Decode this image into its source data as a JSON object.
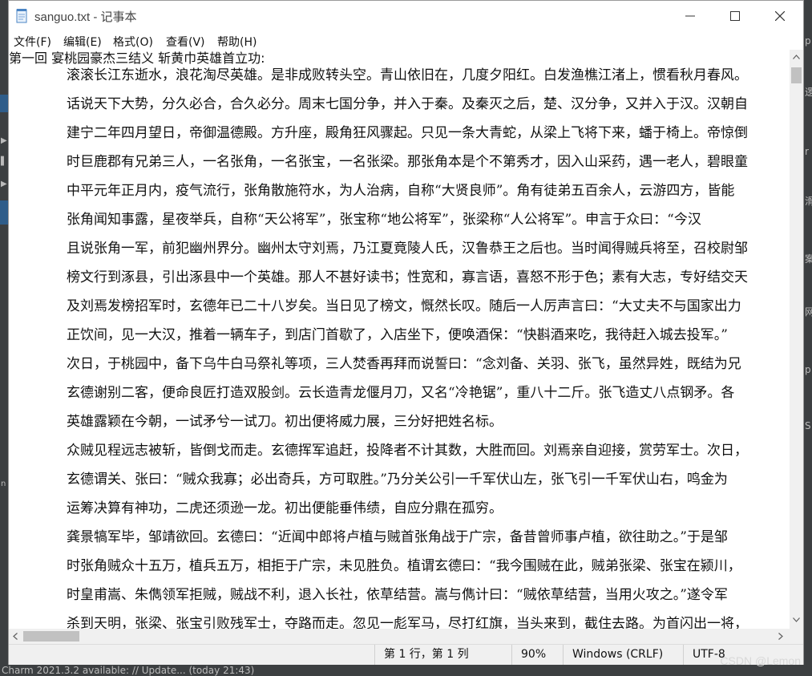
{
  "window": {
    "title": "sanguo.txt - 记事本",
    "minimize_glyph": "─",
    "maximize_glyph": "☐",
    "close_glyph": "✕"
  },
  "menu": [
    "文件(F)",
    "编辑(E)",
    "格式(O)",
    "查看(V)",
    "帮助(H)"
  ],
  "editor": {
    "heading": "第一回  宴桃园豪杰三结义  斩黄巾英雄首立功:",
    "lines": [
      "滚滚长江东逝水，浪花淘尽英雄。是非成败转头空。青山依旧在，几度夕阳红。白发渔樵江渚上，惯看秋月春风。",
      "话说天下大势，分久必合，合久必分。周末七国分争，并入于秦。及秦灭之后，楚、汉分争，又并入于汉。汉朝自",
      "建宁二年四月望日，帝御温德殿。方升座，殿角狂风骤起。只见一条大青蛇，从梁上飞将下来，蟠于椅上。帝惊倒",
      "时巨鹿郡有兄弟三人，一名张角，一名张宝，一名张梁。那张角本是个不第秀才，因入山采药，遇一老人，碧眼童",
      "中平元年正月内，疫气流行，张角散施符水，为人治病，自称“大贤良师”。角有徒弟五百余人，云游四方，皆能",
      "张角闻知事露，星夜举兵，自称“天公将军”，张宝称“地公将军”，张梁称“人公将军”。申言于众曰：“今汉",
      "且说张角一军，前犯幽州界分。幽州太守刘焉，乃江夏竟陵人氏，汉鲁恭王之后也。当时闻得贼兵将至，召校尉邹",
      "榜文行到涿县，引出涿县中一个英雄。那人不甚好读书；性宽和，寡言语，喜怒不形于色；素有大志，专好结交天",
      "及刘焉发榜招军时，玄德年已二十八岁矣。当日见了榜文，慨然长叹。随后一人厉声言曰：“大丈夫不与国家出力",
      "正饮间，见一大汉，推着一辆车子，到店门首歇了，入店坐下，便唤酒保：“快斟酒来吃，我待赶入城去投军。”",
      "次日，于桃园中，备下乌牛白马祭礼等项，三人焚香再拜而说誓曰：“念刘备、关羽、张飞，虽然异姓，既结为兄",
      "玄德谢别二客，便命良匠打造双股剑。云长造青龙偃月刀，又名“冷艳锯”，重八十二斤。张飞造丈八点钢矛。各",
      "英雄露颖在今朝，一试矛兮一试刀。初出便将威力展，三分好把姓名标。",
      "众贼见程远志被斩，皆倒戈而走。玄德挥军追赶，投降者不计其数，大胜而回。刘焉亲自迎接，赏劳军士。次日，",
      "玄德谓关、张曰：“贼众我寡；必出奇兵，方可取胜。”乃分关公引一千军伏山左，张飞引一千军伏山右，鸣金为",
      "运筹决算有神功，二虎还须逊一龙。初出便能垂伟绩，自应分鼎在孤穷。",
      "龚景犒军毕，邹靖欲回。玄德曰：“近闻中郎将卢植与贼首张角战于广宗，备昔曾师事卢植，欲往助之。”于是邹",
      "时张角贼众十五万，植兵五万，相拒于广宗，未见胜负。植谓玄德曰：“我今围贼在此，贼弟张梁、张宝在颍川，",
      "时皇甫嵩、朱儁领军拒贼，贼战不利，退入长社，依草结营。嵩与儁计曰：“贼依草结营，当用火攻之。”遂令军",
      "杀到天明，张梁、张宝引败残军士，夺路而走。忽见一彪军马，尽打红旗，当头来到，截住去路。为首闪出一将，"
    ]
  },
  "statusbar": {
    "position": "第 1 行，第 1 列",
    "zoom": "90%",
    "line_ending": "Windows (CRLF)",
    "encoding": "UTF-8"
  },
  "background": {
    "ide_notice": "Charm 2021.3.2 available: // Update... (today 21:43)",
    "watermark": "CSDN @Lemon"
  },
  "colors": {
    "scrollbar_thumb": "#c1c1c1",
    "ide_background": "#3c3f41"
  }
}
